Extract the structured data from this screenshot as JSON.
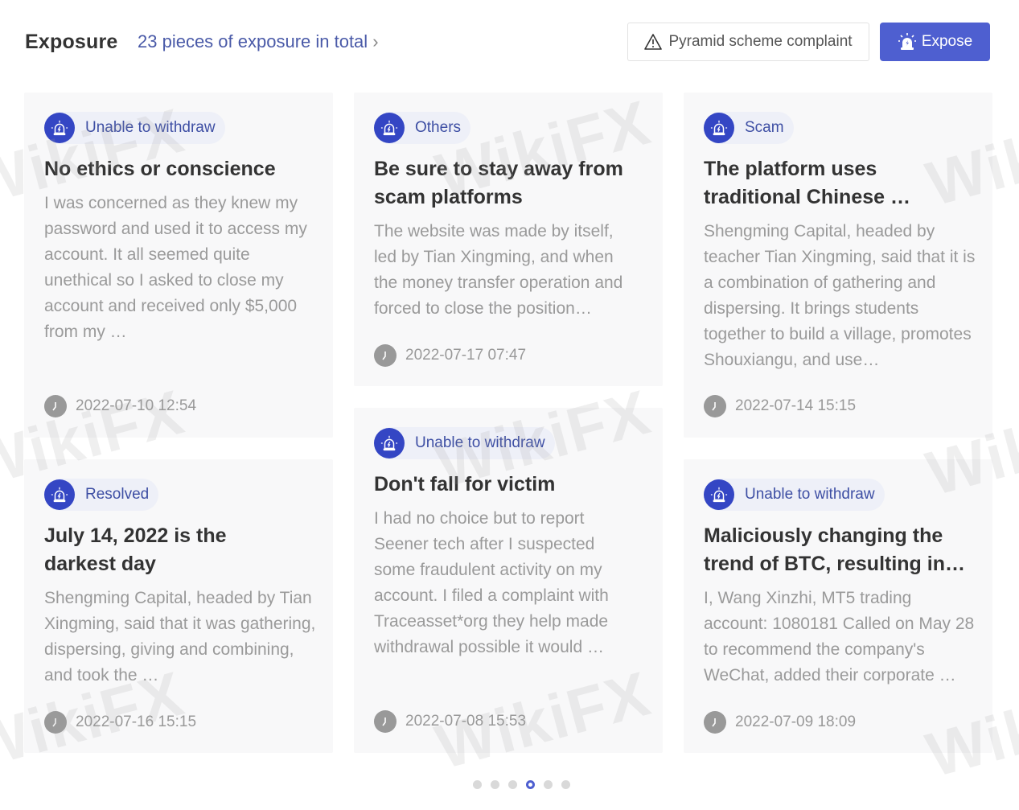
{
  "header": {
    "title": "Exposure",
    "total_link": "23 pieces of exposure in total",
    "complaint_button": "Pyramid scheme complaint",
    "expose_button": "Expose"
  },
  "cards": [
    {
      "tag": "Unable to withdraw",
      "title": "No ethics or conscience",
      "body": "I was concerned as they knew my password and used it to access my account. It all seemed quite unethical so I asked to close my account and received only $5,000 from my …",
      "date": "2022-07-10 12:54"
    },
    {
      "tag": "Others",
      "title": "Be sure to stay away from scam platforms",
      "body": "The website was made by itself, led by Tian Xingming, and when the money transfer operation and forced to close the position…",
      "date": "2022-07-17 07:47"
    },
    {
      "tag": "Scam",
      "title": "The platform uses traditional Chinese …",
      "body": "Shengming Capital, headed by teacher Tian Xingming, said that it is a combination of gathering and dispersing. It brings students together to build a village, promotes Shouxiangu, and use…",
      "date": "2022-07-14 15:15"
    },
    {
      "tag": "Resolved",
      "title": "July 14, 2022 is the darkest day",
      "body": "Shengming Capital, headed by Tian Xingming, said that it was gathering, dispersing, giving and combining, and took the …",
      "date": "2022-07-16 15:15"
    },
    {
      "tag": "Unable to withdraw",
      "title": "Don't fall for victim",
      "body": "I had no choice but to report Seener tech after I suspected some fraudulent activity on my account. I filed a complaint with Traceasset*org they help made withdrawal possible it would …",
      "date": "2022-07-08 15:53"
    },
    {
      "tag": "Unable to withdraw",
      "title": "Maliciously changing the trend of BTC, resulting in…",
      "body": "I, Wang Xinzhi, MT5 trading account: 1080181 Called on May 28 to recommend the company's WeChat, added their corporate …",
      "date": "2022-07-09 18:09"
    }
  ],
  "pagination": {
    "total_pages": 6,
    "active_page": 4
  },
  "watermark": "WikiFX",
  "colors": {
    "accent": "#4e5fd0",
    "tag_icon_bg": "#3446c4",
    "tag_text": "#3e4fa4"
  }
}
